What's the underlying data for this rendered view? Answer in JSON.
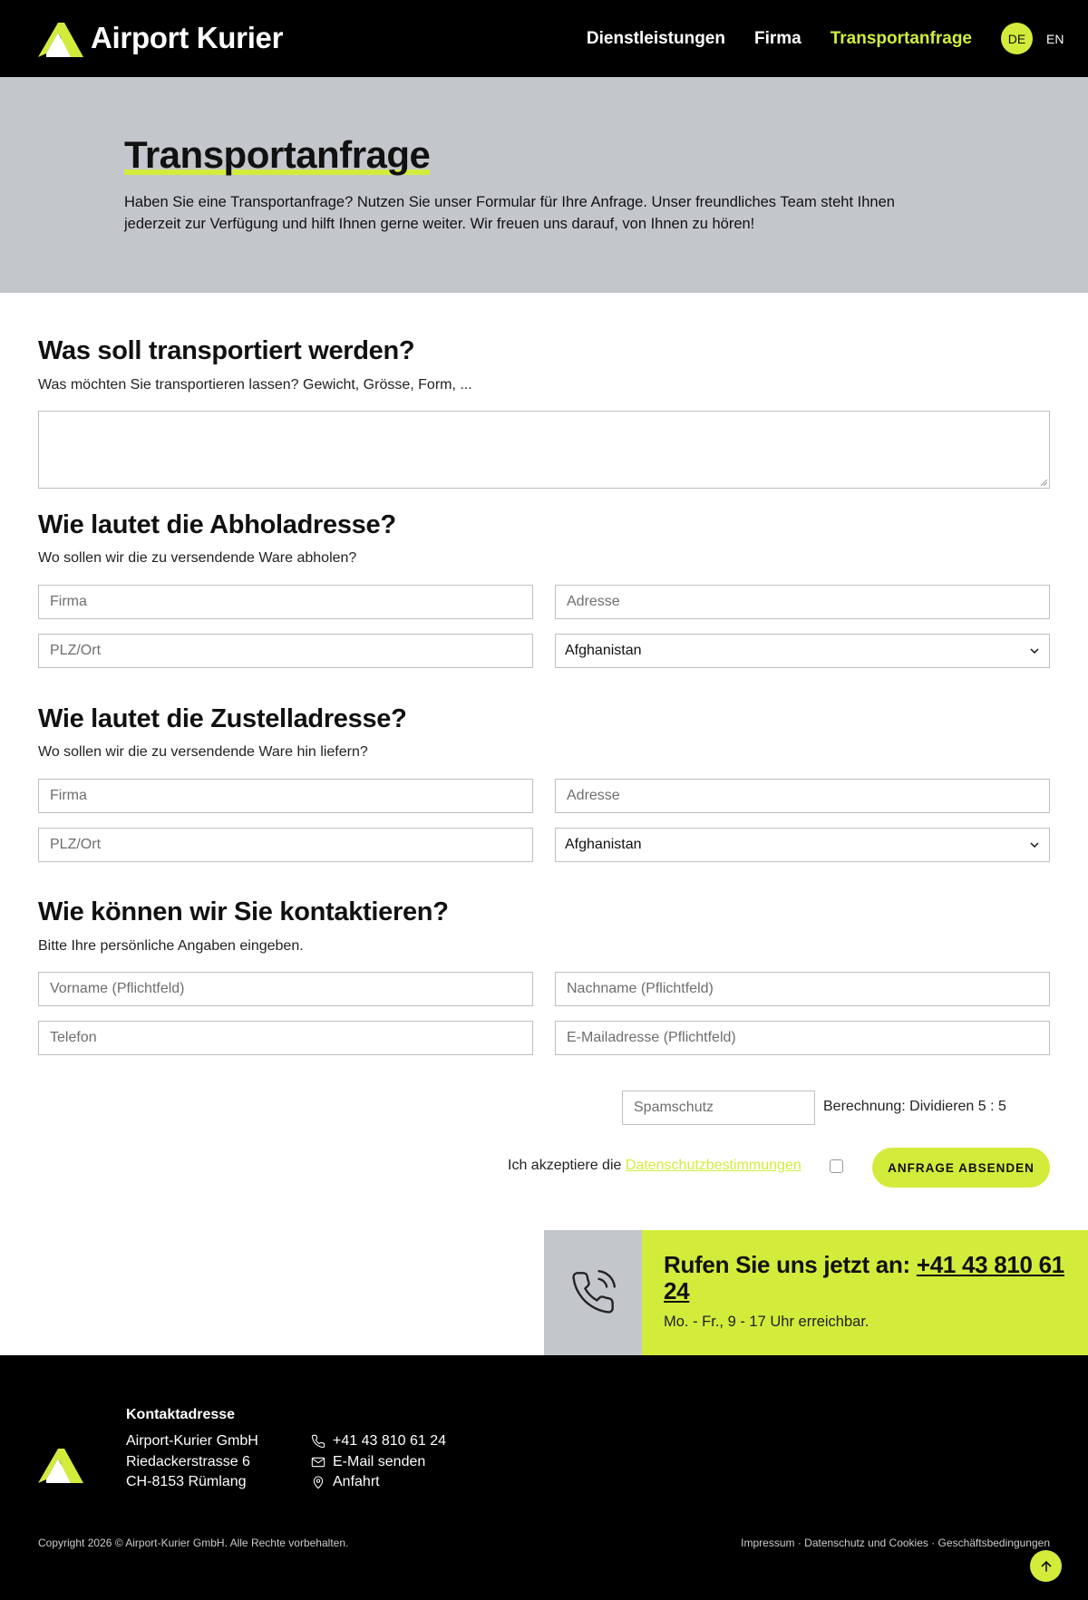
{
  "header": {
    "brand": "Airport Kurier",
    "nav": [
      {
        "label": "Dienstleistungen",
        "active": false
      },
      {
        "label": "Firma",
        "active": false
      },
      {
        "label": "Transportanfrage",
        "active": true
      }
    ],
    "lang_active": "DE",
    "lang_other": "EN"
  },
  "hero": {
    "title": "Transportanfrage",
    "text": "Haben Sie eine Transportanfrage? Nutzen Sie unser Formular für Ihre Anfrage. Unser freundliches Team steht Ihnen jederzeit zur Verfügung und hilft Ihnen gerne weiter. Wir freuen uns darauf, von Ihnen zu hören!"
  },
  "transport": {
    "title": "Was soll transportiert werden?",
    "subtitle": "Was möchten Sie transportieren lassen? Gewicht, Grösse, Form, ...",
    "value": ""
  },
  "pickup": {
    "title": "Wie lautet die Abholadresse?",
    "subtitle": "Wo sollen wir die zu versendende Ware abholen?",
    "company_placeholder": "Firma",
    "address_placeholder": "Adresse",
    "zip_placeholder": "PLZ/Ort",
    "country": "Afghanistan"
  },
  "delivery": {
    "title": "Wie lautet die Zustelladresse?",
    "subtitle": "Wo sollen wir die zu versendende Ware hin liefern?",
    "company_placeholder": "Firma",
    "address_placeholder": "Adresse",
    "zip_placeholder": "PLZ/Ort",
    "country": "Afghanistan"
  },
  "contact": {
    "title": "Wie können wir Sie kontaktieren?",
    "subtitle": "Bitte Ihre persönliche Angaben eingeben.",
    "firstname_placeholder": "Vorname (Pflichtfeld)",
    "lastname_placeholder": "Nachname (Pflichtfeld)",
    "phone_placeholder": "Telefon",
    "email_placeholder": "E-Mailadresse (Pflichtfeld)"
  },
  "spam": {
    "placeholder": "Spamschutz",
    "label": "Berechnung: Dividieren 5 : 5"
  },
  "privacy": {
    "prefix": "Ich akzeptiere die ",
    "link": "Datenschutzbestimmungen",
    "checked": false
  },
  "submit_label": "ANFRAGE ABSENDEN",
  "call": {
    "title_prefix": "Rufen Sie uns jetzt an: ",
    "phone": "+41 43 810 61 24",
    "hours": "Mo. - Fr., 9 - 17 Uhr erreichbar."
  },
  "footer": {
    "heading": "Kontaktadresse",
    "address": [
      "Airport-Kurier GmbH",
      "Riedackerstrasse 6",
      "CH-8153 Rümlang"
    ],
    "phone": "+41 43 810 61 24",
    "email": "E-Mail senden",
    "directions": "Anfahrt",
    "copyright": "Copyright 2026 © Airport-Kurier GmbH. Alle Rechte vorbehalten.",
    "links": "Impressum · Datenschutz und Cookies · Geschäftsbedingungen"
  },
  "colors": {
    "accent": "#d3ec3b",
    "hero_bg": "#c3c7cc",
    "header_bg": "#000000"
  }
}
